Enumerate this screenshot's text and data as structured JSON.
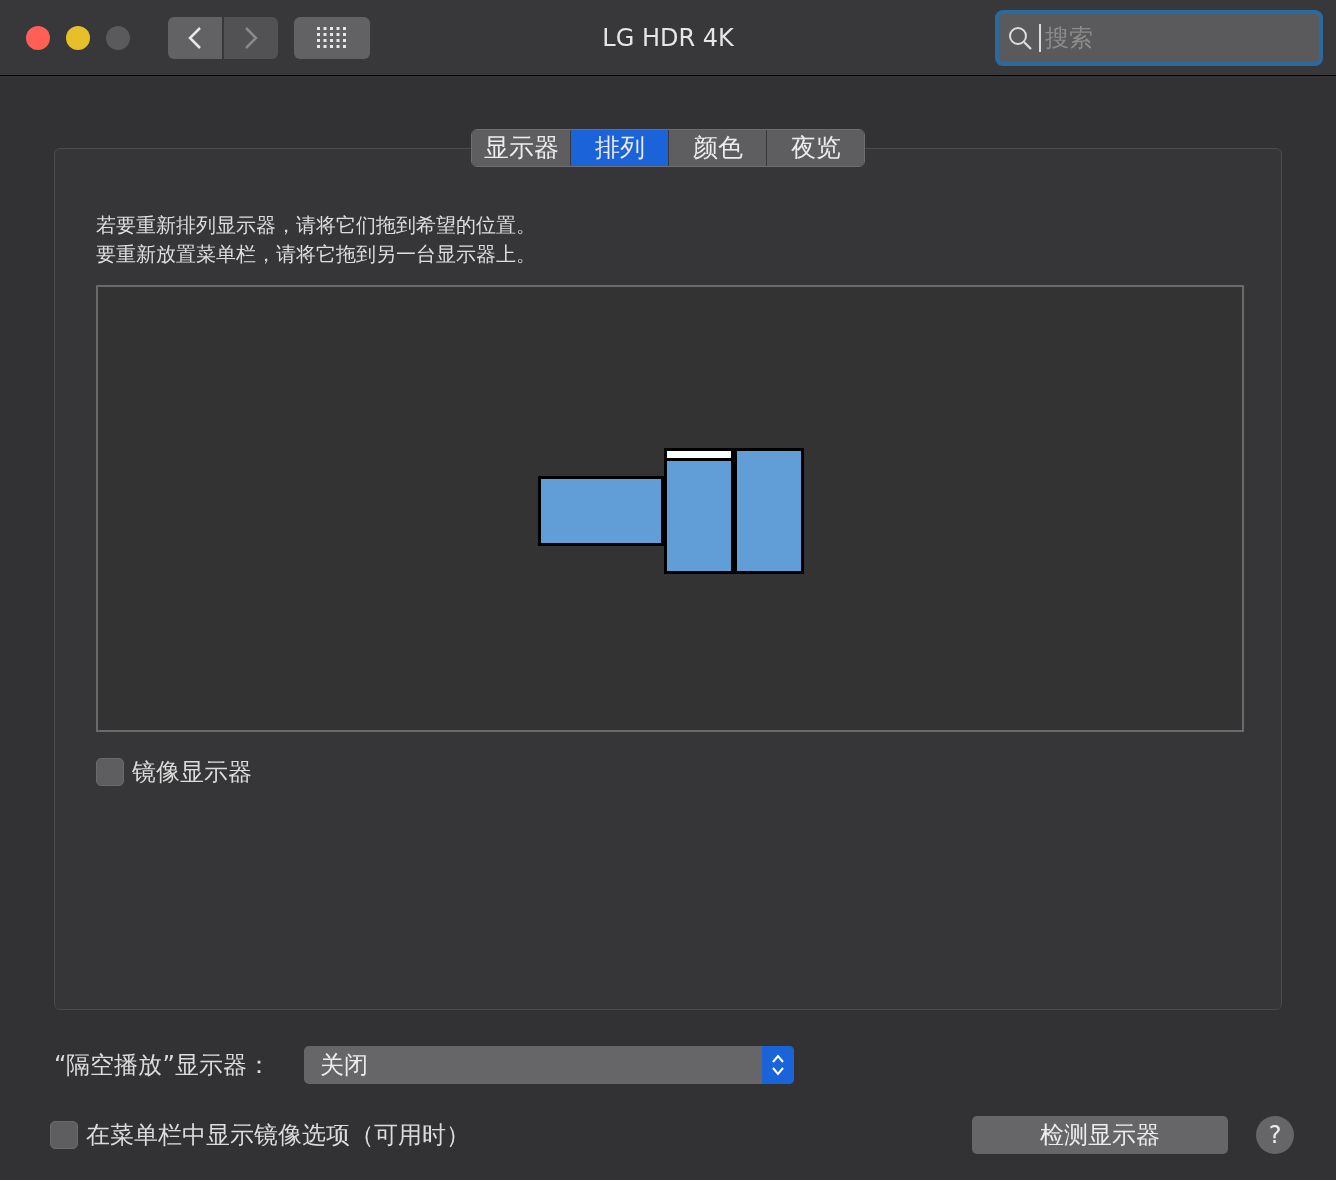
{
  "window": {
    "title": "LG HDR 4K"
  },
  "search": {
    "placeholder": "搜索"
  },
  "tabs": [
    {
      "label": "显示器",
      "selected": false
    },
    {
      "label": "排列",
      "selected": true
    },
    {
      "label": "颜色",
      "selected": false
    },
    {
      "label": "夜览",
      "selected": false
    }
  ],
  "instructions": [
    "若要重新排列显示器，请将它们拖到希望的位置。",
    "要重新放置菜单栏，请将它拖到另一台显示器上。"
  ],
  "displays": [
    {
      "has_menu_bar": false
    },
    {
      "has_menu_bar": true
    },
    {
      "has_menu_bar": false
    }
  ],
  "mirror_displays": {
    "label": "镜像显示器",
    "checked": false
  },
  "airplay": {
    "label": "“隔空播放”显示器：",
    "value": "关闭"
  },
  "show_mirroring_options": {
    "label": "在菜单栏中显示镜像选项（可用时）",
    "checked": false
  },
  "detect_button": "检测显示器",
  "help_button": "?"
}
